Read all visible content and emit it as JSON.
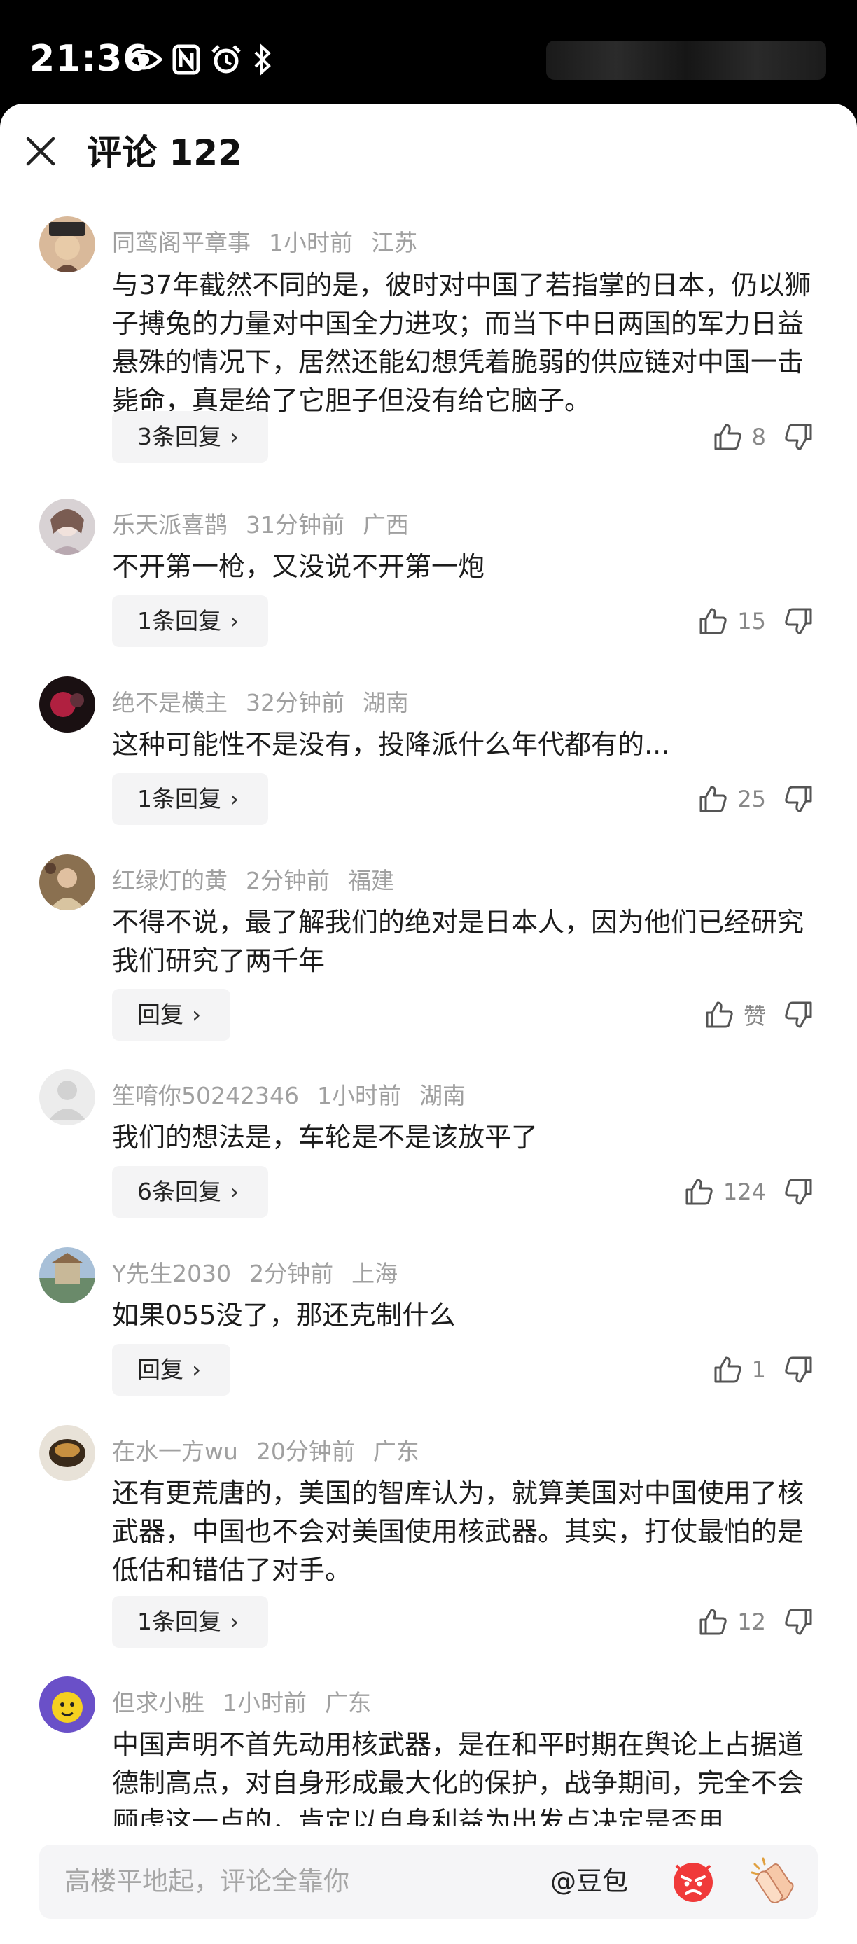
{
  "status_bar": {
    "time": "21:36"
  },
  "header": {
    "title": "评论 122"
  },
  "comments": [
    {
      "user": "同鸾阁平章事",
      "time": "1小时前",
      "location": "江苏",
      "text": "与37年截然不同的是，彼时对中国了若指掌的日本，仍以狮子搏兔的力量对中国全力进攻；而当下中日两国的军力日益悬殊的情况下，居然还能幻想凭着脆弱的供应链对中国一击毙命，真是给了它胆子但没有给它脑子。",
      "reply_label": "3条回复",
      "likes": "8"
    },
    {
      "user": "乐天派喜鹊",
      "time": "31分钟前",
      "location": "广西",
      "text": "不开第一枪，又没说不开第一炮",
      "reply_label": "1条回复",
      "likes": "15"
    },
    {
      "user": "绝不是横主",
      "time": "32分钟前",
      "location": "湖南",
      "text": "这种可能性不是没有，投降派什么年代都有的...",
      "reply_label": "1条回复",
      "likes": "25"
    },
    {
      "user": "红绿灯的黄",
      "time": "2分钟前",
      "location": "福建",
      "text": "不得不说，最了解我们的绝对是日本人，因为他们已经研究我们研究了两千年",
      "reply_label": "回复",
      "likes": "赞"
    },
    {
      "user": "笙唷你50242346",
      "time": "1小时前",
      "location": "湖南",
      "text": "我们的想法是，车轮是不是该放平了",
      "reply_label": "6条回复",
      "likes": "124"
    },
    {
      "user": "Y先生2030",
      "time": "2分钟前",
      "location": "上海",
      "text": "如果055没了，那还克制什么",
      "reply_label": "回复",
      "likes": "1"
    },
    {
      "user": "在水一方wu",
      "time": "20分钟前",
      "location": "广东",
      "text": "还有更荒唐的，美国的智库认为，就算美国对中国使用了核武器，中国也不会对美国使用核武器。其实，打仗最怕的是低估和错估了对手。",
      "reply_label": "1条回复",
      "likes": "12"
    },
    {
      "user": "但求小胜",
      "time": "1小时前",
      "location": "广东",
      "text": "中国声明不首先动用核武器，是在和平时期在舆论上占据道德制高点，对自身形成最大化的保护，战争期间，完全不会顾虑这一点的，肯定以自身利益为出发点决定是否用"
    }
  ],
  "input_bar": {
    "placeholder": "高楼平地起，评论全靠你",
    "mention": "@豆包"
  },
  "colors": {
    "background": "#ffffff",
    "meta_text": "#a0a0a0",
    "reply_bg": "#f4f4f5",
    "status_bar": "#000000"
  },
  "icons": [
    "close-icon",
    "thumbs-up-icon",
    "thumbs-down-icon",
    "angry-face-emoji-icon",
    "clapping-hands-emoji-icon"
  ]
}
